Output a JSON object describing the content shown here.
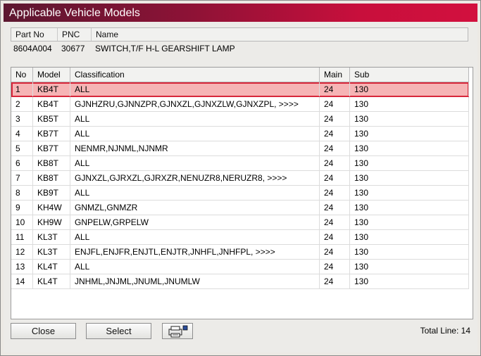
{
  "window": {
    "title": "Applicable Vehicle Models"
  },
  "part": {
    "headers": [
      "Part No",
      "PNC",
      "Name"
    ],
    "part_no": "8604A004",
    "pnc": "30677",
    "name": "SWITCH,T/F H-L GEARSHIFT LAMP"
  },
  "grid": {
    "headers": [
      "No",
      "Model",
      "Classification",
      "Main",
      "Sub"
    ],
    "rows": [
      {
        "no": "1",
        "model": "KB4T",
        "classification": "ALL",
        "main": "24",
        "sub": "130"
      },
      {
        "no": "2",
        "model": "KB4T",
        "classification": "GJNHZRU,GJNNZPR,GJNXZL,GJNXZLW,GJNXZPL,  >>>>",
        "main": "24",
        "sub": "130"
      },
      {
        "no": "3",
        "model": "KB5T",
        "classification": "ALL",
        "main": "24",
        "sub": "130"
      },
      {
        "no": "4",
        "model": "KB7T",
        "classification": "ALL",
        "main": "24",
        "sub": "130"
      },
      {
        "no": "5",
        "model": "KB7T",
        "classification": "NENMR,NJNML,NJNMR",
        "main": "24",
        "sub": "130"
      },
      {
        "no": "6",
        "model": "KB8T",
        "classification": "ALL",
        "main": "24",
        "sub": "130"
      },
      {
        "no": "7",
        "model": "KB8T",
        "classification": "GJNXZL,GJRXZL,GJRXZR,NENUZR8,NERUZR8,  >>>>",
        "main": "24",
        "sub": "130"
      },
      {
        "no": "8",
        "model": "KB9T",
        "classification": "ALL",
        "main": "24",
        "sub": "130"
      },
      {
        "no": "9",
        "model": "KH4W",
        "classification": "GNMZL,GNMZR",
        "main": "24",
        "sub": "130"
      },
      {
        "no": "10",
        "model": "KH9W",
        "classification": "GNPELW,GRPELW",
        "main": "24",
        "sub": "130"
      },
      {
        "no": "11",
        "model": "KL3T",
        "classification": "ALL",
        "main": "24",
        "sub": "130"
      },
      {
        "no": "12",
        "model": "KL3T",
        "classification": "ENJFL,ENJFR,ENJTL,ENJTR,JNHFL,JNHFPL,  >>>>",
        "main": "24",
        "sub": "130"
      },
      {
        "no": "13",
        "model": "KL4T",
        "classification": "ALL",
        "main": "24",
        "sub": "130"
      },
      {
        "no": "14",
        "model": "KL4T",
        "classification": "JNHML,JNJML,JNUML,JNUMLW",
        "main": "24",
        "sub": "130"
      }
    ]
  },
  "buttons": {
    "close": "Close",
    "select": "Select",
    "print_icon": "printer-icon"
  },
  "footer": {
    "total": "Total Line: 14"
  },
  "colors": {
    "title_start": "#5c1730",
    "title_end": "#d2103e",
    "selected_row": "#f6b4b5",
    "selected_border": "#d8263a"
  }
}
